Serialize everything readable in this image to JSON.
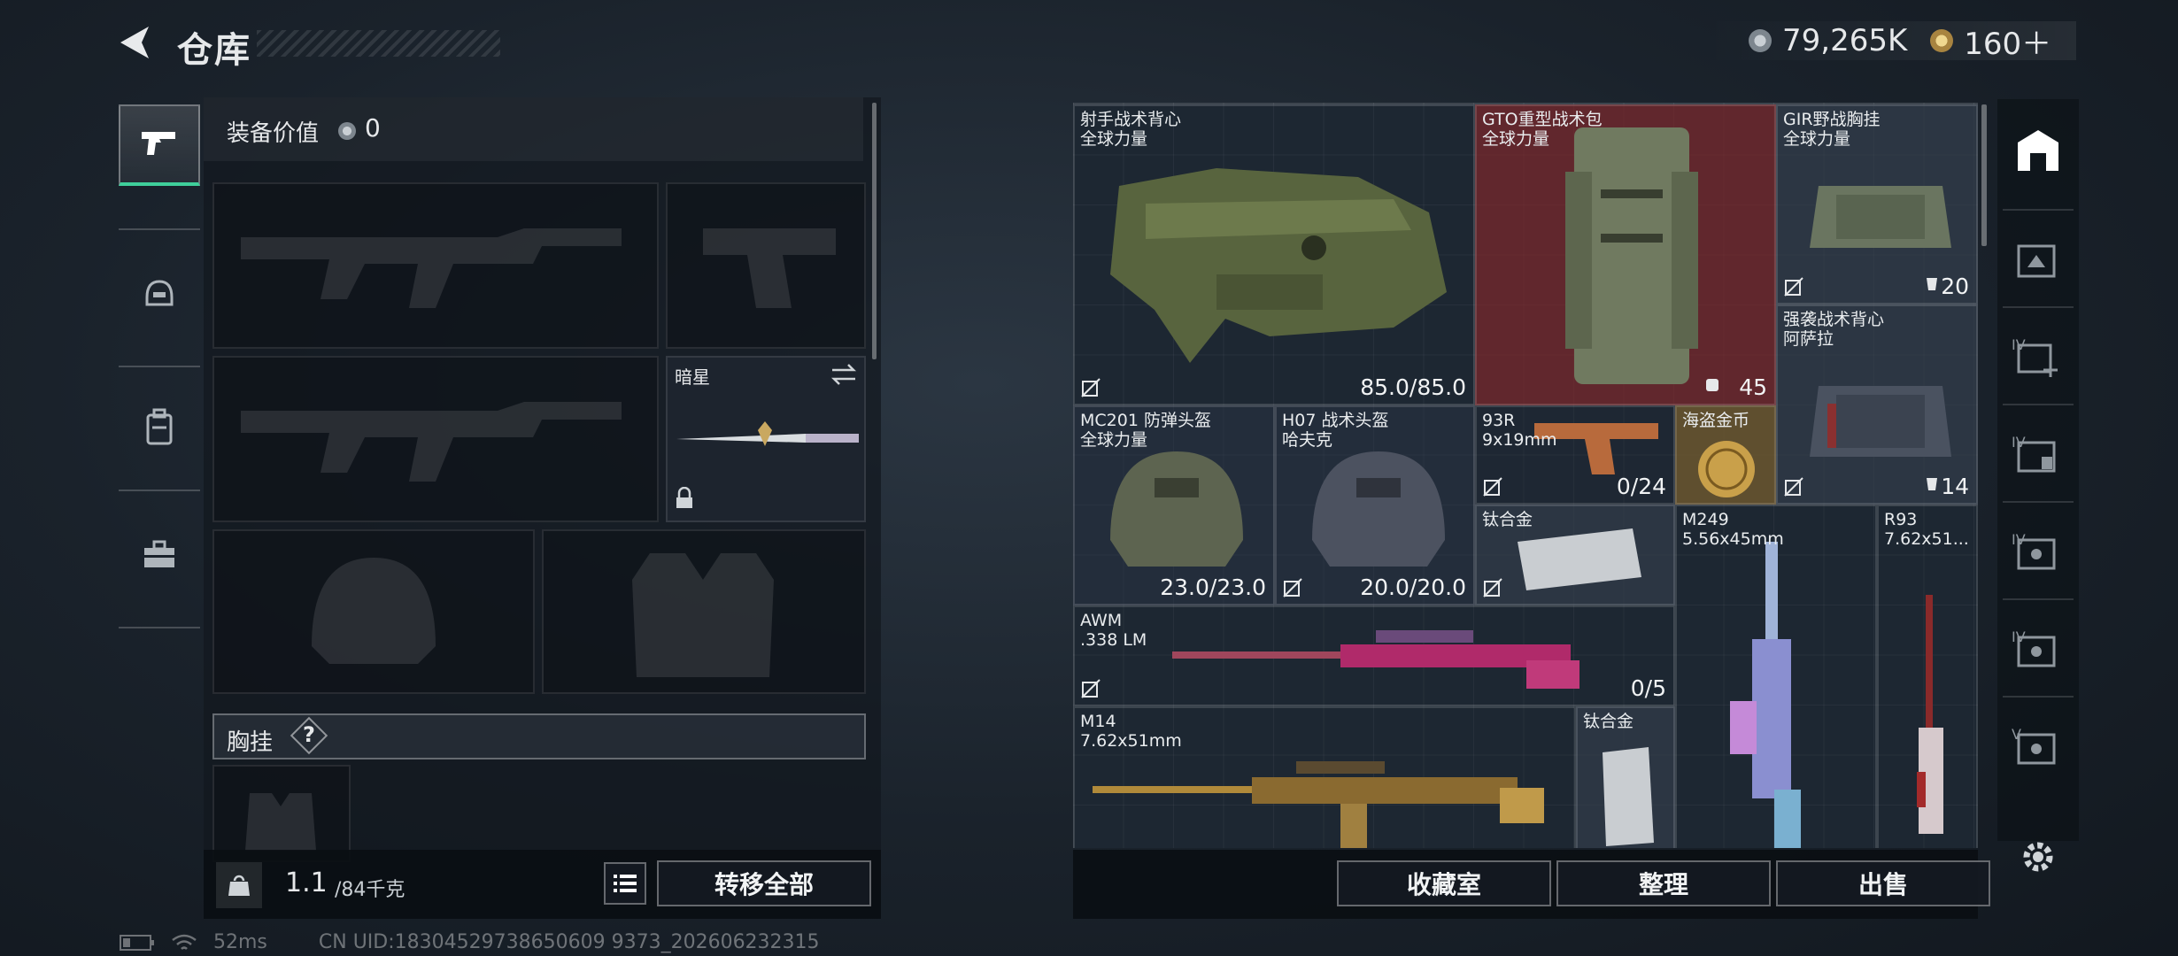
{
  "header": {
    "title": "仓库",
    "currency_main": "79,265K",
    "currency_premium": "160＋",
    "colors": {
      "main_coin": "#9aa3ab",
      "premium_coin": "#c9a860"
    }
  },
  "left_tabs": [
    {
      "name": "weapons",
      "icon": "pistol-icon",
      "active": true
    },
    {
      "name": "armor",
      "icon": "helmet-icon",
      "active": false
    },
    {
      "name": "backpack",
      "icon": "backpack-icon",
      "active": false
    },
    {
      "name": "case",
      "icon": "briefcase-icon",
      "active": false
    }
  ],
  "loadout": {
    "value_label": "装备价值",
    "value": "0",
    "melee_name": "暗星",
    "chest_rig_label": "胸挂",
    "chest_rig_help": "?",
    "weight_current": "1.1",
    "weight_max": "/84千克",
    "transfer_all": "转移全部"
  },
  "stash": {
    "items": [
      {
        "id": "vest1",
        "line1": "射手战术背心",
        "line2": "全球力量",
        "value": "85.0/85.0",
        "icon": "armor-vest-icon"
      },
      {
        "id": "bag1",
        "line1": "GTO重型战术包",
        "line2": "全球力量",
        "value": "45",
        "icon": "backpack-icon"
      },
      {
        "id": "rig1",
        "line1": "GIR野战胸挂",
        "line2": "全球力量",
        "value": "20",
        "icon": "chest-rig-icon"
      },
      {
        "id": "vest2",
        "line1": "强袭战术背心",
        "line2": "阿萨拉",
        "value": "14",
        "icon": "chest-rig-icon"
      },
      {
        "id": "helm1",
        "line1": "MC201 防弹头盔",
        "line2": "全球力量",
        "value": "23.0/23.0",
        "icon": "helmet-icon"
      },
      {
        "id": "helm2",
        "line1": "H07 战术头盔",
        "line2": "哈夫克",
        "value": "20.0/20.0",
        "icon": "helmet-icon"
      },
      {
        "id": "pistol",
        "line1": "93R",
        "line2": "9x19mm",
        "value": "0/24",
        "icon": "pistol-icon"
      },
      {
        "id": "coin",
        "line1": "海盗金币",
        "line2": "",
        "value": "",
        "icon": "gold-coin-icon"
      },
      {
        "id": "ti1",
        "line1": "钛合金",
        "line2": "",
        "value": "",
        "icon": "titanium-plate-icon"
      },
      {
        "id": "m249",
        "line1": "M249",
        "line2": "5.56x45mm",
        "value": "",
        "icon": "machine-gun-icon"
      },
      {
        "id": "r93",
        "line1": "R93",
        "line2": "7.62x51...",
        "value": "",
        "icon": "sniper-rifle-icon"
      },
      {
        "id": "awm",
        "line1": "AWM",
        "line2": ".338 LM",
        "value": "0/5",
        "icon": "sniper-rifle-icon"
      },
      {
        "id": "m14",
        "line1": "M14",
        "line2": "7.62x51mm",
        "value": "",
        "icon": "rifle-icon"
      },
      {
        "id": "ti2",
        "line1": "钛合金",
        "line2": "",
        "value": "",
        "icon": "titanium-plate-icon"
      }
    ],
    "btn_collection": "收藏室",
    "btn_sort": "整理",
    "btn_sell": "出售"
  },
  "right_sidebar": [
    {
      "icon": "stash-home-icon",
      "label": ""
    },
    {
      "icon": "stash-tab-icon",
      "label": ""
    },
    {
      "icon": "add-stash-icon",
      "label": "IV"
    },
    {
      "icon": "stash-tab-icon",
      "label": "IV"
    },
    {
      "icon": "stash-tab-icon",
      "label": "IV"
    },
    {
      "icon": "stash-tab-icon",
      "label": "IV"
    },
    {
      "icon": "stash-tab-icon",
      "label": "V"
    },
    {
      "icon": "settings-icon",
      "label": ""
    }
  ],
  "status": {
    "ping": "52ms",
    "uid": "CN UID:18304529738650609 9373_202606232315"
  }
}
